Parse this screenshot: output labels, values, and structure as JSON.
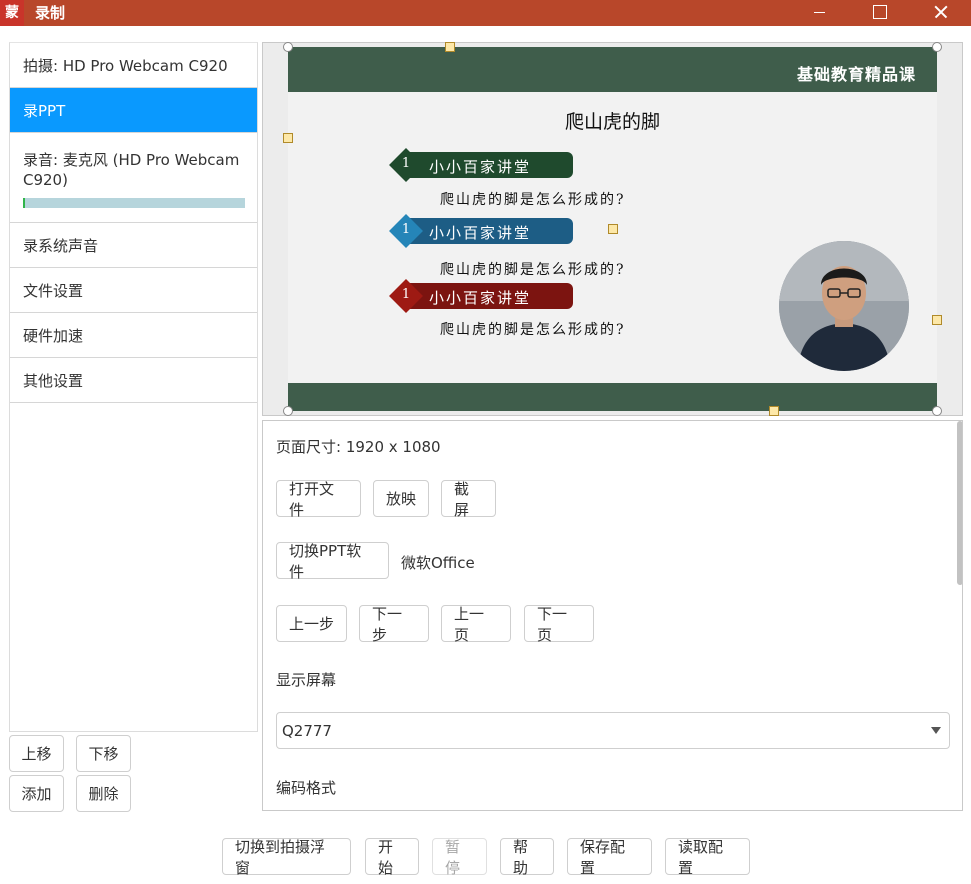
{
  "window": {
    "app_icon_text": "蒙",
    "title": "录制"
  },
  "left_list": {
    "items": [
      {
        "label": "拍摄: HD Pro Webcam C920",
        "selected": false
      },
      {
        "label": "录PPT",
        "selected": true
      },
      {
        "label": "录音: 麦克风 (HD Pro Webcam C920)",
        "selected": false,
        "level_fraction": 0.01
      },
      {
        "label": "录系统声音",
        "selected": false
      },
      {
        "label": "文件设置",
        "selected": false
      },
      {
        "label": "硬件加速",
        "selected": false
      },
      {
        "label": "其他设置",
        "selected": false
      }
    ],
    "buttons": {
      "up": "上移",
      "down": "下移",
      "add": "添加",
      "delete": "删除"
    }
  },
  "slide": {
    "brand": "基础教育精品课",
    "title": "爬山虎的脚",
    "items": [
      {
        "num": "1",
        "label": "小小百家讲堂",
        "sub": "爬山虎的脚是怎么形成的?",
        "color": "#1f4a2d"
      },
      {
        "num": "1",
        "label": "小小百家讲堂",
        "sub": "爬山虎的脚是怎么形成的?",
        "color": "#1d5d85"
      },
      {
        "num": "1",
        "label": "小小百家讲堂",
        "sub": "爬山虎的脚是怎么形成的?",
        "color": "#7c1410"
      }
    ]
  },
  "settings": {
    "page_size": "页面尺寸: 1920 x 1080",
    "open_file": "打开文件",
    "play": "放映",
    "screenshot": "截屏",
    "switch_ppt": "切换PPT软件",
    "ppt_software": "微软Office",
    "prev_step": "上一步",
    "next_step": "下一步",
    "prev_page": "上一页",
    "next_page": "下一页",
    "display_screen_label": "显示屏幕",
    "display_screen_value": "Q2777",
    "encode_format_label": "编码格式"
  },
  "bottom_bar": {
    "switch_float": "切换到拍摄浮窗",
    "start": "开始",
    "pause": "暂停",
    "help": "帮助",
    "save_config": "保存配置",
    "load_config": "读取配置"
  },
  "colors": {
    "titlebar": "#b8472a",
    "selected": "#0a99fe",
    "slide_green": "#3f5d4b"
  }
}
